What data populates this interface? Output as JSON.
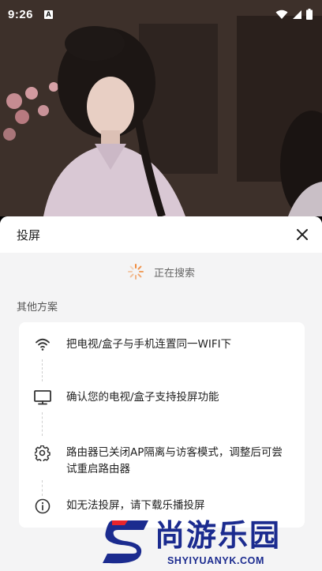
{
  "status_bar": {
    "time": "9:26",
    "notification_icon": "A"
  },
  "video": {
    "description_icon": "video-frame"
  },
  "sheet": {
    "title": "投屏",
    "close_icon": "close-icon",
    "searching_text": "正在搜索",
    "other_solutions_label": "其他方案",
    "steps": [
      {
        "icon": "wifi-icon",
        "text": "把电视/盒子与手机连置同一WIFI下"
      },
      {
        "icon": "monitor-icon",
        "text": "确认您的电视/盒子支持投屏功能"
      },
      {
        "icon": "gear-icon",
        "text": "路由器已关闭AP隔离与访客模式，调整后可尝试重启路由器"
      },
      {
        "icon": "info-icon",
        "text": "如无法投屏，请下载乐播投屏"
      }
    ]
  },
  "watermark": {
    "title": "尚游乐园",
    "domain": "SHYIYUANYK.COM",
    "brand_color": "#1b2b8f",
    "accent_color": "#e8242b"
  }
}
